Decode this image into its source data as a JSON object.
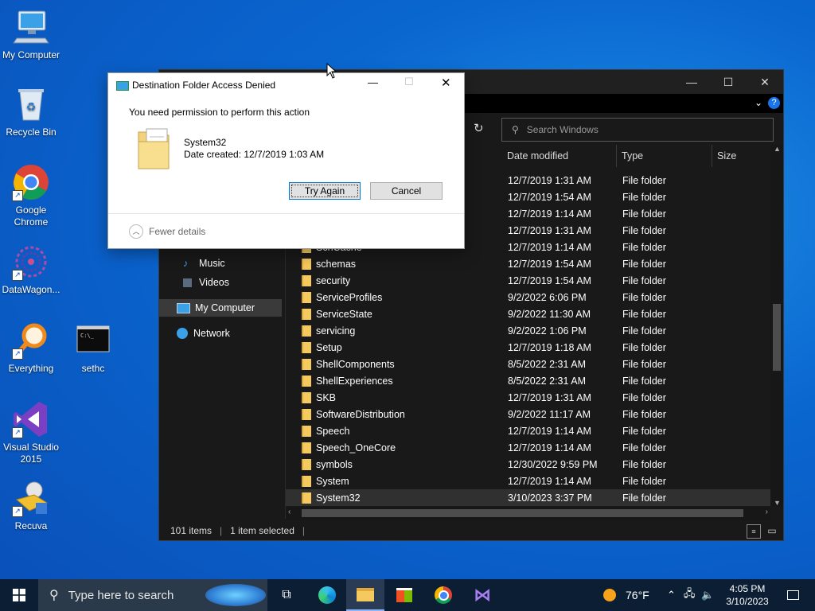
{
  "desktop": {
    "icons": [
      {
        "label": "My Computer"
      },
      {
        "label": "Recycle Bin"
      },
      {
        "label": "Google Chrome"
      },
      {
        "label": "DataWagon..."
      },
      {
        "label": "Everything"
      },
      {
        "label": "sethc"
      },
      {
        "label": "Visual Studio 2015"
      },
      {
        "label": "Recuva"
      }
    ]
  },
  "explorer": {
    "search_placeholder": "Search Windows",
    "columns": {
      "date": "Date modified",
      "type": "Type",
      "size": "Size"
    },
    "nav": [
      {
        "label": "Music",
        "icon": "music-icon"
      },
      {
        "label": "Videos",
        "icon": "videos-icon"
      },
      {
        "label": "My Computer",
        "icon": "computer-icon"
      },
      {
        "label": "Network",
        "icon": "network-icon"
      }
    ],
    "partial_rows": [
      {
        "date": "12/7/2019 1:31 AM",
        "type": "File folder"
      },
      {
        "date": "12/7/2019 1:54 AM",
        "type": "File folder"
      },
      {
        "date": "12/7/2019 1:14 AM",
        "type": "File folder"
      },
      {
        "date": "12/7/2019 1:31 AM",
        "type": "File folder"
      }
    ],
    "rows": [
      {
        "name": "SchCache",
        "date": "12/7/2019 1:14 AM",
        "type": "File folder"
      },
      {
        "name": "schemas",
        "date": "12/7/2019 1:54 AM",
        "type": "File folder"
      },
      {
        "name": "security",
        "date": "12/7/2019 1:54 AM",
        "type": "File folder"
      },
      {
        "name": "ServiceProfiles",
        "date": "9/2/2022 6:06 PM",
        "type": "File folder"
      },
      {
        "name": "ServiceState",
        "date": "9/2/2022 11:30 AM",
        "type": "File folder"
      },
      {
        "name": "servicing",
        "date": "9/2/2022 1:06 PM",
        "type": "File folder"
      },
      {
        "name": "Setup",
        "date": "12/7/2019 1:18 AM",
        "type": "File folder"
      },
      {
        "name": "ShellComponents",
        "date": "8/5/2022 2:31 AM",
        "type": "File folder"
      },
      {
        "name": "ShellExperiences",
        "date": "8/5/2022 2:31 AM",
        "type": "File folder"
      },
      {
        "name": "SKB",
        "date": "12/7/2019 1:31 AM",
        "type": "File folder"
      },
      {
        "name": "SoftwareDistribution",
        "date": "9/2/2022 11:17 AM",
        "type": "File folder"
      },
      {
        "name": "Speech",
        "date": "12/7/2019 1:14 AM",
        "type": "File folder"
      },
      {
        "name": "Speech_OneCore",
        "date": "12/7/2019 1:14 AM",
        "type": "File folder"
      },
      {
        "name": "symbols",
        "date": "12/30/2022 9:59 PM",
        "type": "File folder"
      },
      {
        "name": "System",
        "date": "12/7/2019 1:14 AM",
        "type": "File folder"
      },
      {
        "name": "System32",
        "date": "3/10/2023 3:37 PM",
        "type": "File folder",
        "selected": true
      }
    ],
    "status": {
      "items": "101 items",
      "selected": "1 item selected"
    }
  },
  "dialog": {
    "title": "Destination Folder Access Denied",
    "message": "You need permission to perform this action",
    "folder_name": "System32",
    "date_created": "Date created: 12/7/2019 1:03 AM",
    "try_again": "Try Again",
    "cancel": "Cancel",
    "fewer_details": "Fewer details"
  },
  "taskbar": {
    "search_placeholder": "Type here to search",
    "weather": "76°F",
    "time": "4:05 PM",
    "date": "3/10/2023"
  },
  "colors": {
    "accent": "#0078d7",
    "taskbar": "#0b1e33",
    "folder": "#f4c95d"
  }
}
